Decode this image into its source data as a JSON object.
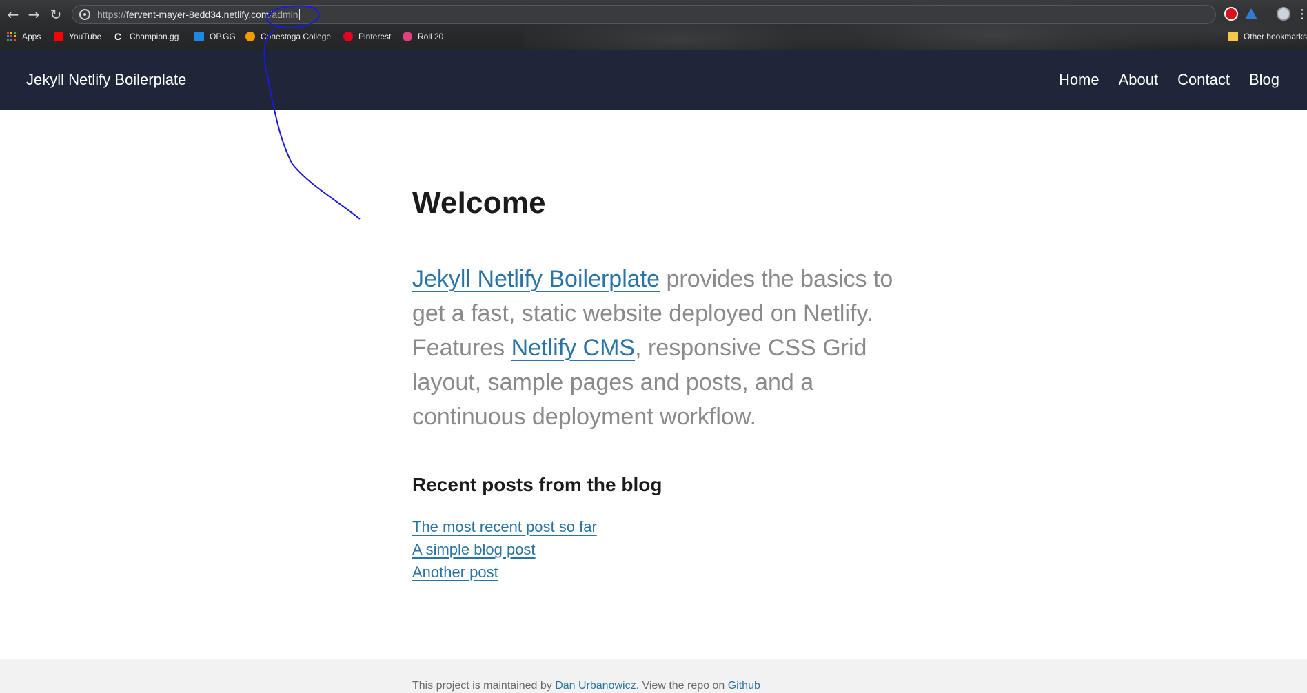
{
  "browser": {
    "url_scheme": "https://",
    "url_host": "fervent-mayer-8edd34.netlify.com",
    "url_path": "/admin",
    "bookmarks": [
      {
        "label": "Apps",
        "icon": "apps-grid-icon"
      },
      {
        "label": "YouTube",
        "icon": "youtube-icon",
        "color": "#ff0000"
      },
      {
        "label": "Champion.gg",
        "icon": "champion-gg-icon"
      },
      {
        "label": "OP.GG",
        "icon": "opgg-icon",
        "color": "#1e88e5"
      },
      {
        "label": "Conestoga College",
        "icon": "conestoga-icon",
        "color": "#f59b00"
      },
      {
        "label": "Pinterest",
        "icon": "pinterest-icon",
        "color": "#e60023"
      },
      {
        "label": "Roll 20",
        "icon": "roll20-icon",
        "color": "#e0407b"
      }
    ],
    "other_bookmarks": "Other bookmarks"
  },
  "site": {
    "title": "Jekyll Netlify Boilerplate",
    "nav": [
      "Home",
      "About",
      "Contact",
      "Blog"
    ],
    "header_bg": "#1f2639"
  },
  "main": {
    "heading": "Welcome",
    "intro_link1": "Jekyll Netlify Boilerplate",
    "intro_text1": " provides the basics to get a fast, static website deployed on Netlify. Features ",
    "intro_link2": "Netlify CMS",
    "intro_text2": ", responsive CSS Grid layout, sample pages and posts, and a continuous deployment workflow.",
    "recent_heading": "Recent posts from the blog",
    "posts": [
      "The most recent post so far",
      "A simple blog post",
      "Another post"
    ],
    "link_color": "#2a74a5"
  },
  "footer": {
    "text1": "This project is maintained by ",
    "author": "Dan Urbanowicz",
    "text2": ". View the repo on ",
    "repo": "Github"
  },
  "annotation": {
    "color": "#1a1adb"
  }
}
